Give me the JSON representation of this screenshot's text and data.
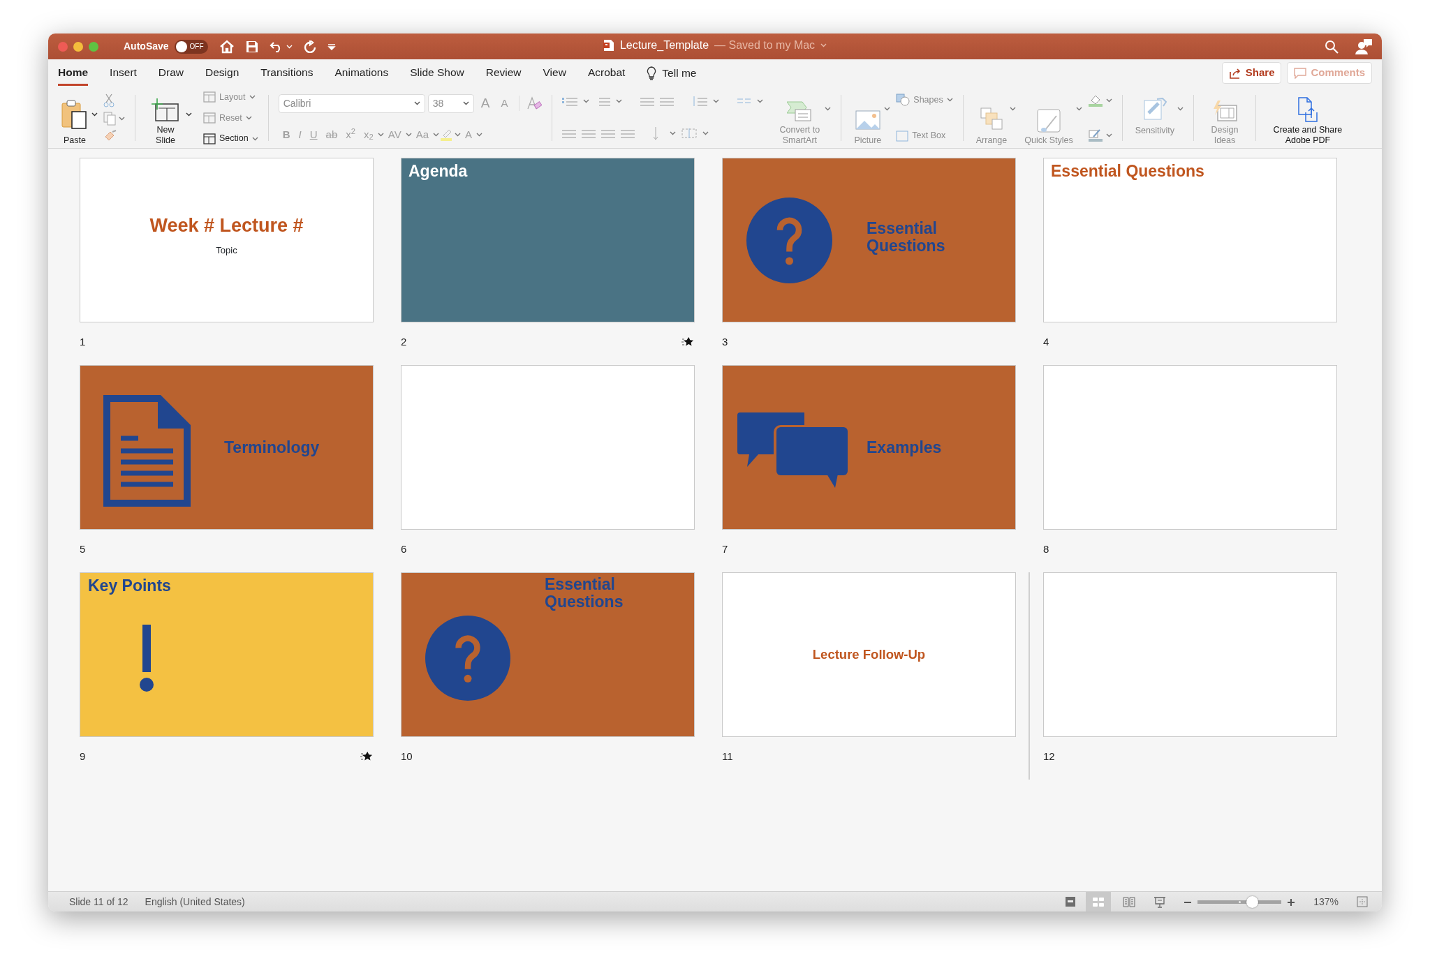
{
  "window": {
    "title": "Lecture_Template",
    "subtitle": "— Saved to my Mac"
  },
  "autosave": {
    "label": "AutoSave",
    "on": false,
    "state": "OFF"
  },
  "tabs": [
    {
      "label": "Home",
      "selected": true
    },
    {
      "label": "Insert",
      "selected": false
    },
    {
      "label": "Draw",
      "selected": false
    },
    {
      "label": "Design",
      "selected": false
    },
    {
      "label": "Transitions",
      "selected": false
    },
    {
      "label": "Animations",
      "selected": false
    },
    {
      "label": "Slide Show",
      "selected": false
    },
    {
      "label": "Review",
      "selected": false
    },
    {
      "label": "View",
      "selected": false
    },
    {
      "label": "Acrobat",
      "selected": false
    }
  ],
  "tell_me": "Tell me",
  "share_button": "Share",
  "comments_button": {
    "label": "Comments",
    "disabled": true
  },
  "ribbon": {
    "paste": "Paste",
    "new_slide": "New Slide",
    "slide_items": [
      {
        "label": "Layout",
        "disabled": true
      },
      {
        "label": "Reset",
        "disabled": true
      },
      {
        "label": "Section",
        "disabled": false
      }
    ],
    "font": {
      "family": "Calibri",
      "size": "38",
      "grow": "A",
      "shrink": "A",
      "disabled": true
    },
    "format_buttons": [
      "B",
      "I",
      "U",
      "ab",
      "x$^{2}$",
      "x$_{2}$",
      "AV",
      "Aa",
      "A"
    ],
    "convert": {
      "label": "Convert to SmartArt",
      "disabled": true
    },
    "insert": {
      "picture": "Picture",
      "shapes": "Shapes",
      "text_box": "Text Box",
      "disabled": true
    },
    "drawing": {
      "arrange": "Arrange",
      "quick_styles": "Quick Styles",
      "disabled": true
    },
    "sensitivity": {
      "label": "Sensitivity",
      "disabled": true
    },
    "design_ideas": {
      "label": "Design Ideas",
      "disabled": true
    },
    "adobe": {
      "label": "Create and Share Adobe PDF",
      "disabled": false
    }
  },
  "slides": [
    {
      "number": "1",
      "kind": "title",
      "title": "Week # Lecture #",
      "subtitle": "Topic",
      "color": "#ffffff",
      "animated": false,
      "selected": false
    },
    {
      "number": "2",
      "kind": "heading",
      "title": "Agenda",
      "color": "#4a7384",
      "animated": true,
      "selected": false
    },
    {
      "number": "3",
      "kind": "question-section",
      "title": "Essential Questions",
      "color": "#b9622f",
      "animated": false,
      "selected": false
    },
    {
      "number": "4",
      "kind": "heading",
      "title": "Essential Questions",
      "color": "#ffffff",
      "animated": false,
      "selected": false
    },
    {
      "number": "5",
      "kind": "document-section",
      "title": "Terminology",
      "color": "#b9622f",
      "animated": false,
      "selected": false
    },
    {
      "number": "6",
      "kind": "blank",
      "color": "#ffffff",
      "animated": false,
      "selected": false
    },
    {
      "number": "7",
      "kind": "chat-section",
      "title": "Examples",
      "color": "#b9622f",
      "animated": false,
      "selected": false
    },
    {
      "number": "8",
      "kind": "blank",
      "color": "#ffffff",
      "animated": false,
      "selected": false
    },
    {
      "number": "9",
      "kind": "exclamation-heading",
      "title": "Key Points",
      "color": "#f4c142",
      "animated": true,
      "selected": false
    },
    {
      "number": "10",
      "kind": "question-top",
      "title": "Essential Questions",
      "color": "#b9622f",
      "animated": false,
      "selected": false
    },
    {
      "number": "11",
      "kind": "centered",
      "title": "Lecture Follow-Up",
      "color": "#ffffff",
      "animated": false,
      "selected": true
    },
    {
      "number": "12",
      "kind": "blank",
      "color": "#ffffff",
      "animated": false,
      "selected": false
    }
  ],
  "status_bar": {
    "slide": "Slide 11 of 12",
    "language": "English (United States)",
    "views": [
      {
        "selected": false
      },
      {
        "selected": true
      },
      {
        "selected": false
      },
      {
        "selected": false
      }
    ],
    "zoom": {
      "level": 0.65,
      "label": "137%"
    }
  }
}
